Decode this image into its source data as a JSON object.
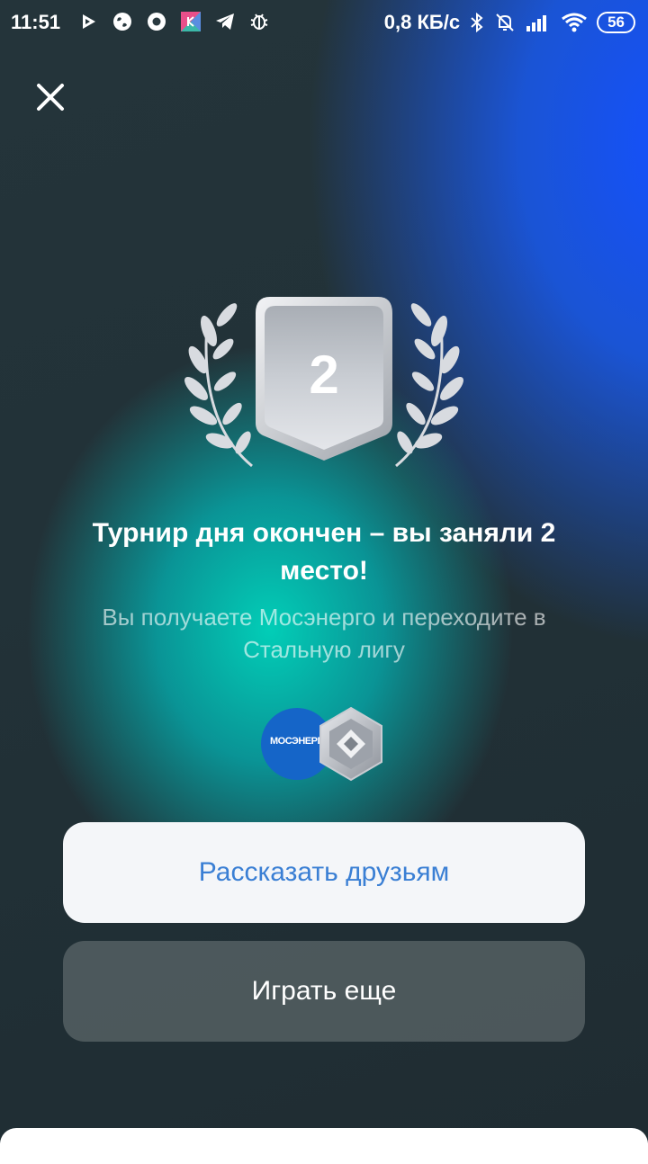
{
  "status_bar": {
    "time": "11:51",
    "network_speed": "0,8 КБ/с",
    "battery": "56",
    "icons_left": [
      "play-icon",
      "globe-icon",
      "record-icon",
      "app-icon",
      "telegram-icon",
      "bug-icon"
    ],
    "icons_right": [
      "bluetooth-icon",
      "bell-muted-icon",
      "signal-icon",
      "wifi-icon"
    ]
  },
  "header": {
    "close_icon": "close-icon"
  },
  "badge": {
    "place": "2",
    "icon": "laurel-shield-icon"
  },
  "result": {
    "title": "Турнир дня окончен – вы заняли 2 место!",
    "subtitle": "Вы получаете Мосэнерго и переходите в Стальную лигу"
  },
  "rewards": {
    "company_logo_text": "МОСЭНЕРГО",
    "league_icon": "steel-league-icon"
  },
  "actions": {
    "share_label": "Рассказать друзьям",
    "play_again_label": "Играть еще"
  },
  "colors": {
    "accent_blue": "#3a7fd4",
    "teal_glow": "#00d6be",
    "blue_glow": "#1450ff"
  }
}
